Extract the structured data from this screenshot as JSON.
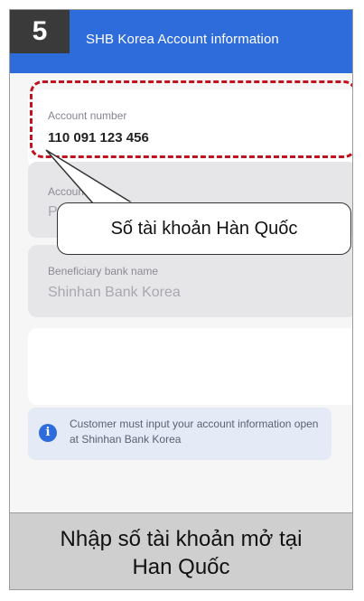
{
  "step": {
    "number": "5"
  },
  "header": {
    "title": "SHB Korea Account information"
  },
  "fields": {
    "account_number": {
      "label": "Account number",
      "value": "110 091 123 456"
    },
    "account_name": {
      "label": "Account",
      "value": "P"
    },
    "beneficiary_bank": {
      "label": "Beneficiary bank name",
      "value": "Shinhan Bank Korea"
    }
  },
  "callout": {
    "text": "Số tài khoản Hàn Quốc"
  },
  "notice": {
    "icon": "info-icon",
    "text": "Customer must input your account information open at Shinhan Bank Korea"
  },
  "caption": {
    "line1": "Nhập số tài khoản mở tại",
    "line2": "Han Quốc"
  },
  "colors": {
    "header": "#2f6cdb",
    "highlight": "#c1121f",
    "caption_bg": "#cfcfcf"
  }
}
